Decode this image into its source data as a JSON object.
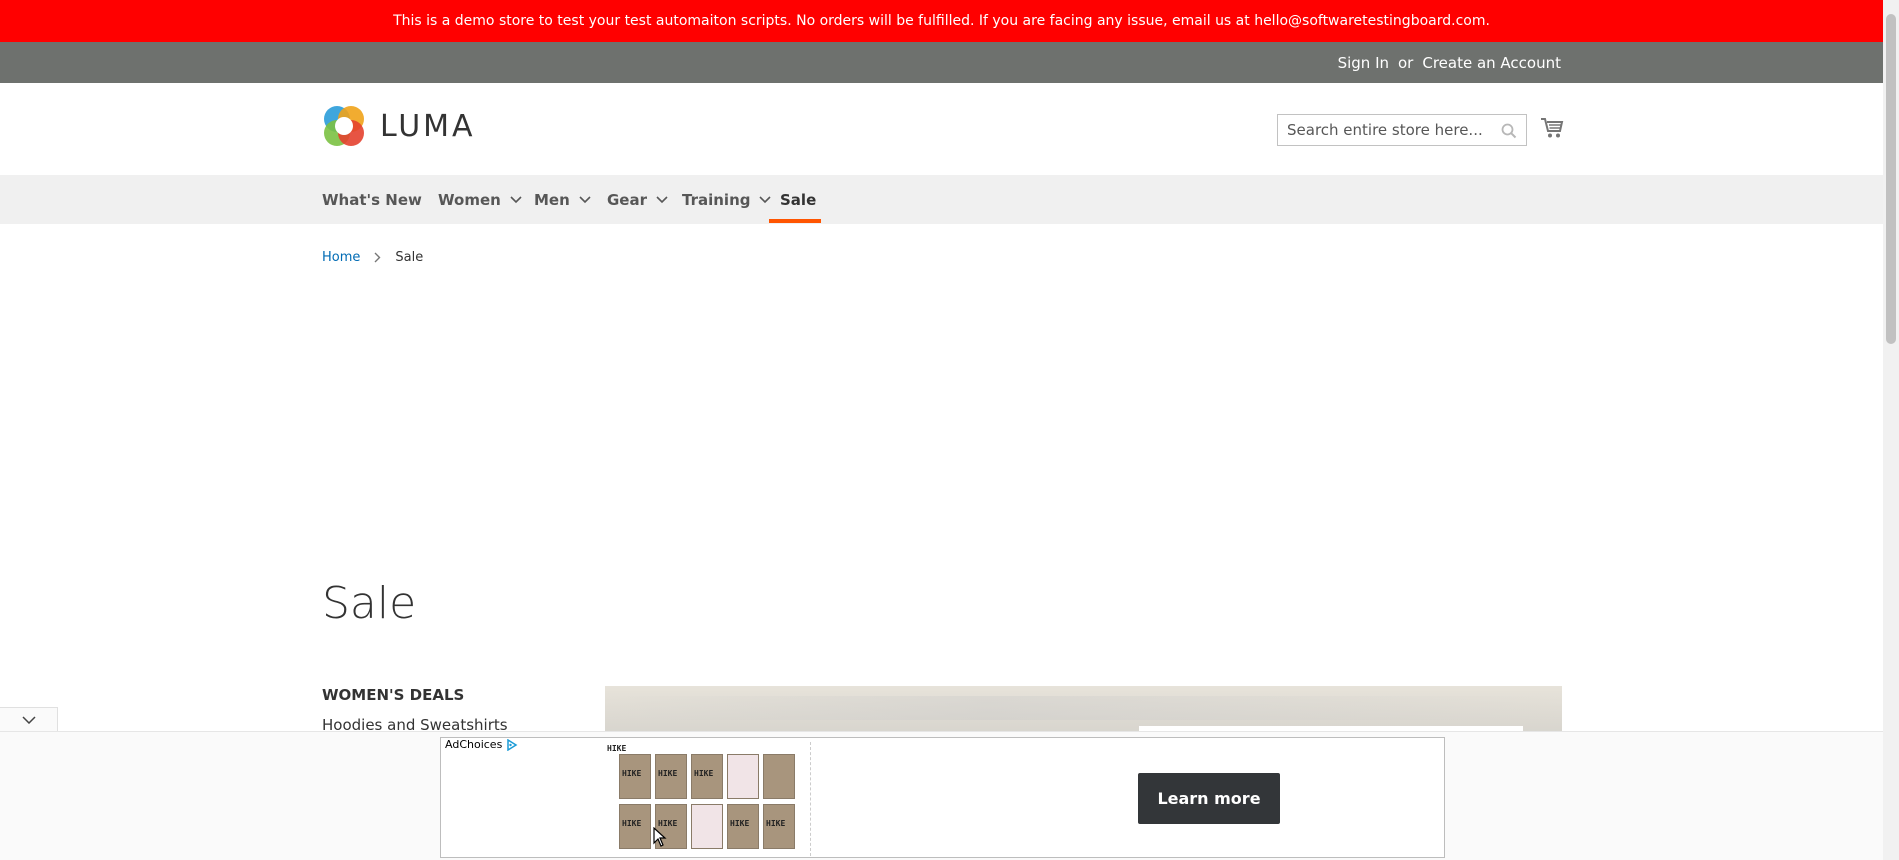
{
  "banner": {
    "text": "This is a demo store to test your test automaiton scripts. No orders will be fulfilled. If you are facing any issue, email us at hello@softwaretestingboard.com."
  },
  "header": {
    "sign_in": "Sign In",
    "or": "or",
    "create_account": "Create an Account",
    "logo_text": "LUMA",
    "search_placeholder": "Search entire store here...",
    "icons": [
      "search-icon",
      "cart-icon"
    ]
  },
  "nav": {
    "items": [
      {
        "label": "What's New",
        "has_dropdown": false
      },
      {
        "label": "Women",
        "has_dropdown": true
      },
      {
        "label": "Men",
        "has_dropdown": true
      },
      {
        "label": "Gear",
        "has_dropdown": true
      },
      {
        "label": "Training",
        "has_dropdown": true
      },
      {
        "label": "Sale",
        "has_dropdown": false,
        "active": true
      }
    ],
    "active_color": "#ff5501"
  },
  "breadcrumbs": {
    "home": "Home",
    "current": "Sale"
  },
  "page": {
    "title": "Sale"
  },
  "sidebar": {
    "section_title": "WOMEN'S DEALS",
    "links": [
      "Hoodies and Sweatshirts"
    ]
  },
  "ad": {
    "adchoices": "AdChoices",
    "product_tag": "HIKE",
    "cell_label": "HIKE",
    "cta": "Learn more"
  },
  "colors": {
    "banner": "#ff0000",
    "panel": "#6e716e",
    "nav_bg": "#f0f0f0",
    "link": "#006bb4"
  }
}
